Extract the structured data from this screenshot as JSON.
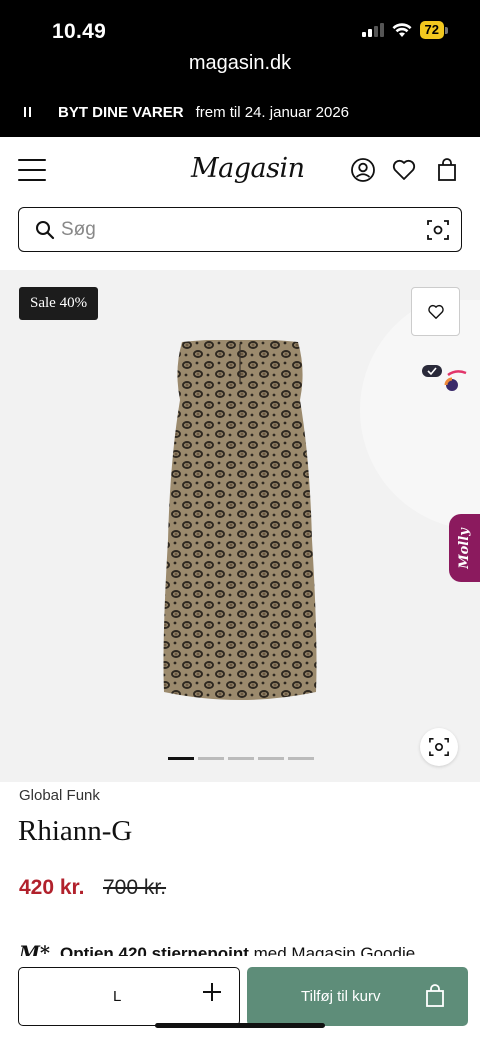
{
  "status_bar": {
    "time": "10.49",
    "battery": "72"
  },
  "browser": {
    "url": "magasin.dk"
  },
  "promo": {
    "bold": "BYT DINE VARER",
    "text": "frem til 24. januar 2026"
  },
  "header": {
    "logo": "Magasin"
  },
  "search": {
    "placeholder": "Søg"
  },
  "gallery": {
    "sale_badge": "Sale 40%",
    "image_count": 5,
    "active_image": 1,
    "molly_label": "Molly"
  },
  "product": {
    "brand": "Global Funk",
    "name": "Rhiann-G",
    "price": "420 kr.",
    "old_price": "700 kr."
  },
  "points": {
    "logo": "M*",
    "bold": "Optjen 420 stjernepoint",
    "text": "med Magasin Goodie"
  },
  "bottom_bar": {
    "size": "L",
    "add_to_cart": "Tilføj til kurv"
  },
  "colors": {
    "price_red": "#b1212c",
    "cart_green": "#5e8d79",
    "molly_purple": "#8b1a5e"
  }
}
